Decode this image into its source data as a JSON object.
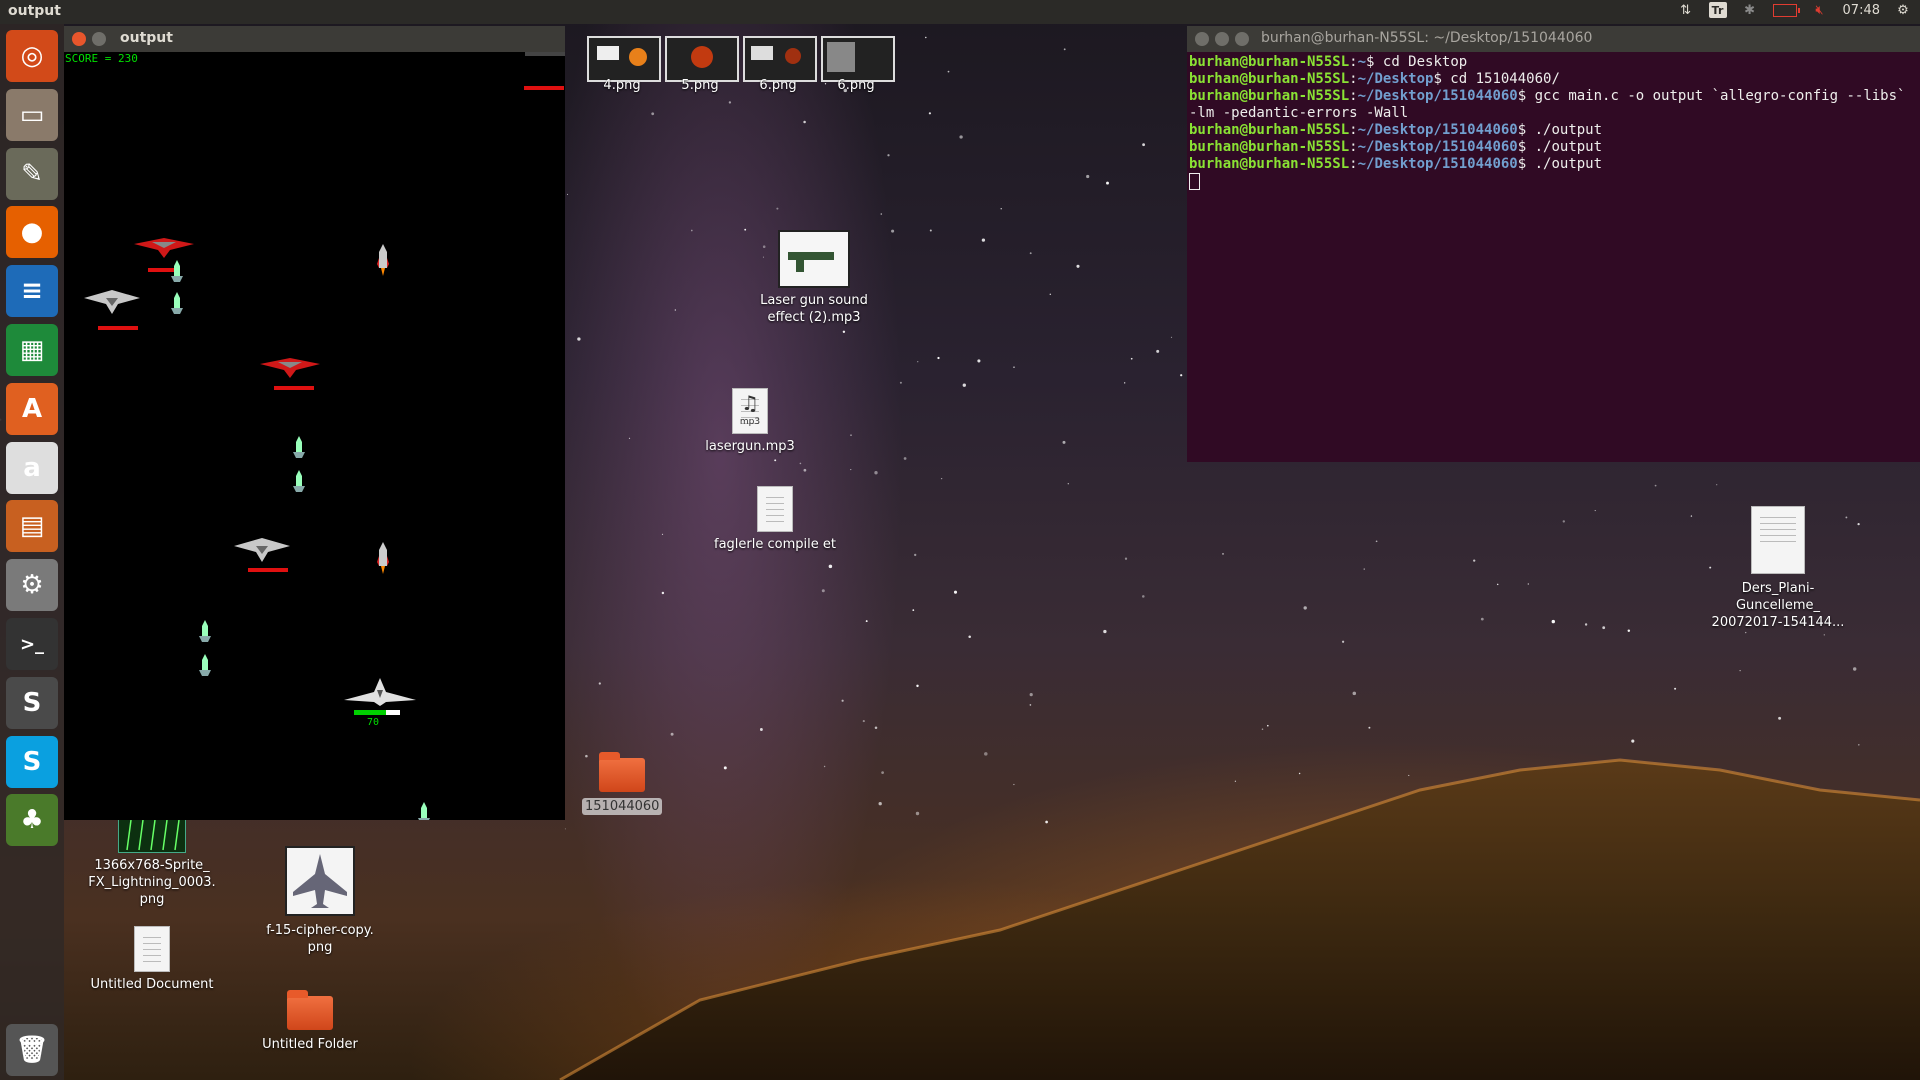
{
  "top_panel": {
    "app_title": "output",
    "keyboard_layout": "Tr",
    "clock": "07:48"
  },
  "launcher": {
    "items": [
      {
        "name": "ubuntu-dash",
        "glyph": "◎",
        "color": "#d24a19"
      },
      {
        "name": "files",
        "glyph": "▭",
        "color": "#8a7a6a"
      },
      {
        "name": "gimp",
        "glyph": "✎",
        "color": "#6a6a5a"
      },
      {
        "name": "firefox",
        "glyph": "●",
        "color": "#e66000"
      },
      {
        "name": "libreoffice-writer",
        "glyph": "≡",
        "color": "#1e6bb8"
      },
      {
        "name": "libreoffice-calc",
        "glyph": "▦",
        "color": "#1e8a3a"
      },
      {
        "name": "software-center",
        "glyph": "A",
        "color": "#e06020"
      },
      {
        "name": "amazon",
        "glyph": "a",
        "color": "#dedede"
      },
      {
        "name": "libreoffice-impress",
        "glyph": "▤",
        "color": "#c86020"
      },
      {
        "name": "system-settings",
        "glyph": "⚙",
        "color": "#7a7a7a"
      },
      {
        "name": "terminal",
        "glyph": ">_",
        "color": "#333333"
      },
      {
        "name": "sublime-text",
        "glyph": "S",
        "color": "#4a4a4a"
      },
      {
        "name": "skype",
        "glyph": "S",
        "color": "#0aa0e0"
      },
      {
        "name": "gator-app",
        "glyph": "♣",
        "color": "#4a7a2a"
      },
      {
        "name": "trash",
        "glyph": "🗑",
        "color": "#555555"
      }
    ]
  },
  "game_window": {
    "title": "output",
    "score_text": "SCORE = 230",
    "player_hp_text": "70",
    "player_hp_fraction": 0.7
  },
  "terminal": {
    "title": "burhan@burhan-N55SL: ~/Desktop/151044060",
    "lines": [
      {
        "user": "burhan@burhan-N55SL",
        "path": "~",
        "cmd": "cd Desktop"
      },
      {
        "user": "burhan@burhan-N55SL",
        "path": "~/Desktop",
        "cmd": "cd 151044060/"
      },
      {
        "user": "burhan@burhan-N55SL",
        "path": "~/Desktop/151044060",
        "cmd": "gcc main.c -o output `allegro-config --libs` -lm -pedantic-errors -Wall"
      },
      {
        "user": "burhan@burhan-N55SL",
        "path": "~/Desktop/151044060",
        "cmd": "./output"
      },
      {
        "user": "burhan@burhan-N55SL",
        "path": "~/Desktop/151044060",
        "cmd": "./output"
      },
      {
        "user": "burhan@burhan-N55SL",
        "path": "~/Desktop/151044060",
        "cmd": "./output"
      }
    ]
  },
  "desktop": {
    "thumbs": [
      "4.png",
      "5.png",
      "6.png",
      "6.png"
    ],
    "laser_sound": "Laser gun sound effect (2).mp3",
    "lasergun": "lasergun.mp3",
    "mp3_tag": "mp3",
    "faglerle": "faglerle compile et",
    "folder_151": "151044060",
    "ders_plani": "Ders_Plani-Guncelleme_ 20072017-154144...",
    "sprite_lightning": "1366x768-Sprite_ FX_Lightning_0003. png",
    "f15": "f-15-cipher-copy. png",
    "untitled_doc": "Untitled Document",
    "untitled_folder": "Untitled Folder"
  }
}
